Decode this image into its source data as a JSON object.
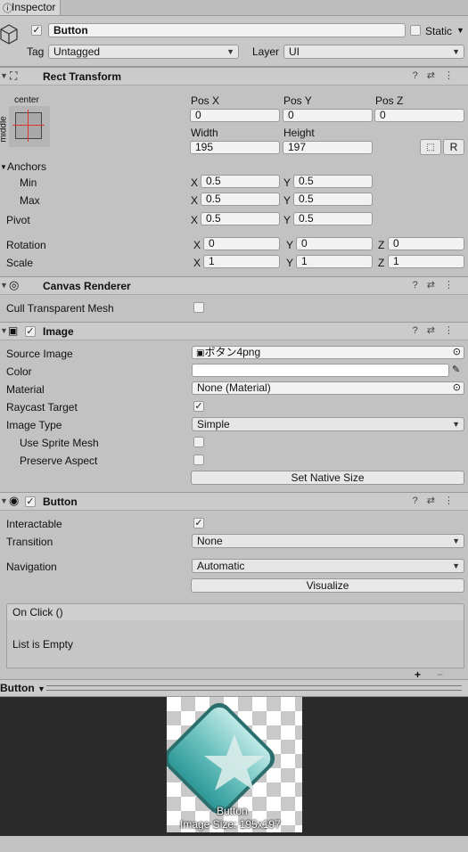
{
  "tab_title": "Inspector",
  "gameobject": {
    "name": "Button",
    "static_label": "Static",
    "tag_label": "Tag",
    "tag_value": "Untagged",
    "layer_label": "Layer",
    "layer_value": "UI"
  },
  "rect_transform": {
    "title": "Rect Transform",
    "anchor_preset_h": "center",
    "anchor_preset_v": "middle",
    "posx_label": "Pos X",
    "posy_label": "Pos Y",
    "posz_label": "Pos Z",
    "posx": "0",
    "posy": "0",
    "posz": "0",
    "width_label": "Width",
    "height_label": "Height",
    "width": "195",
    "height": "197",
    "r_button": "R",
    "anchors_label": "Anchors",
    "min_label": "Min",
    "max_label": "Max",
    "pivot_label": "Pivot",
    "x": "X",
    "y": "Y",
    "z": "Z",
    "min_x": "0.5",
    "min_y": "0.5",
    "max_x": "0.5",
    "max_y": "0.5",
    "pivot_x": "0.5",
    "pivot_y": "0.5",
    "rotation_label": "Rotation",
    "rot_x": "0",
    "rot_y": "0",
    "rot_z": "0",
    "scale_label": "Scale",
    "scale_x": "1",
    "scale_y": "1",
    "scale_z": "1"
  },
  "canvas_renderer": {
    "title": "Canvas Renderer",
    "cull_label": "Cull Transparent Mesh"
  },
  "image": {
    "title": "Image",
    "source_label": "Source Image",
    "source_value": "ボタン4png",
    "color_label": "Color",
    "material_label": "Material",
    "material_value": "None (Material)",
    "raycast_label": "Raycast Target",
    "type_label": "Image Type",
    "type_value": "Simple",
    "sprite_mesh_label": "Use Sprite Mesh",
    "preserve_label": "Preserve Aspect",
    "native_size_button": "Set Native Size"
  },
  "button": {
    "title": "Button",
    "interactable_label": "Interactable",
    "transition_label": "Transition",
    "transition_value": "None",
    "navigation_label": "Navigation",
    "navigation_value": "Automatic",
    "visualize_button": "Visualize",
    "onclick_label": "On Click ()",
    "list_empty": "List is Empty",
    "plus": "+",
    "minus": "−"
  },
  "preview": {
    "dropdown": "Button",
    "caption_name": "Button",
    "caption_size": "Image Size: 195x197"
  }
}
